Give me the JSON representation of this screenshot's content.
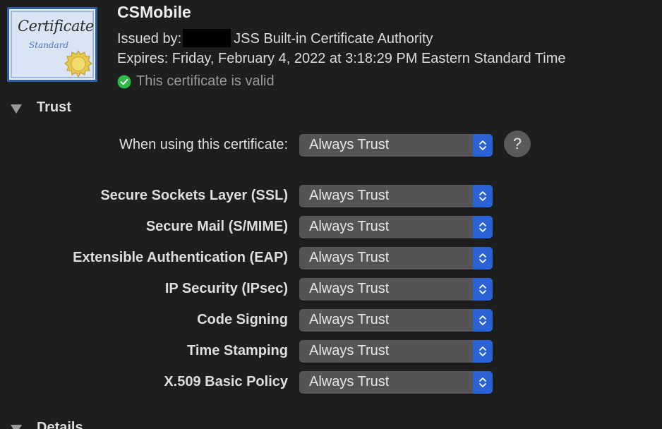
{
  "certificate": {
    "icon_title": "Certificate",
    "icon_subtitle": "Standard",
    "name": "CSMobile",
    "issued_by_label": "Issued by:",
    "issued_by_value": "JSS Built-in Certificate Authority",
    "expires": "Expires: Friday, February 4, 2022 at 3:18:29 PM Eastern Standard Time",
    "status": "This certificate is valid",
    "status_icon": "checkmark-circle-icon",
    "status_color": "#2fb84a"
  },
  "trust": {
    "section_label": "Trust",
    "expanded": true,
    "when_using_label": "When using this certificate:",
    "when_using_value": "Always Trust",
    "help_label": "?",
    "rows": [
      {
        "label": "Secure Sockets Layer (SSL)",
        "value": "Always Trust"
      },
      {
        "label": "Secure Mail (S/MIME)",
        "value": "Always Trust"
      },
      {
        "label": "Extensible Authentication (EAP)",
        "value": "Always Trust"
      },
      {
        "label": "IP Security (IPsec)",
        "value": "Always Trust"
      },
      {
        "label": "Code Signing",
        "value": "Always Trust"
      },
      {
        "label": "Time Stamping",
        "value": "Always Trust"
      },
      {
        "label": "X.509 Basic Policy",
        "value": "Always Trust"
      }
    ]
  },
  "details": {
    "section_label": "Details"
  },
  "colors": {
    "accent": "#2b63d6",
    "background": "#1e1e1e",
    "popup": "#545454"
  }
}
